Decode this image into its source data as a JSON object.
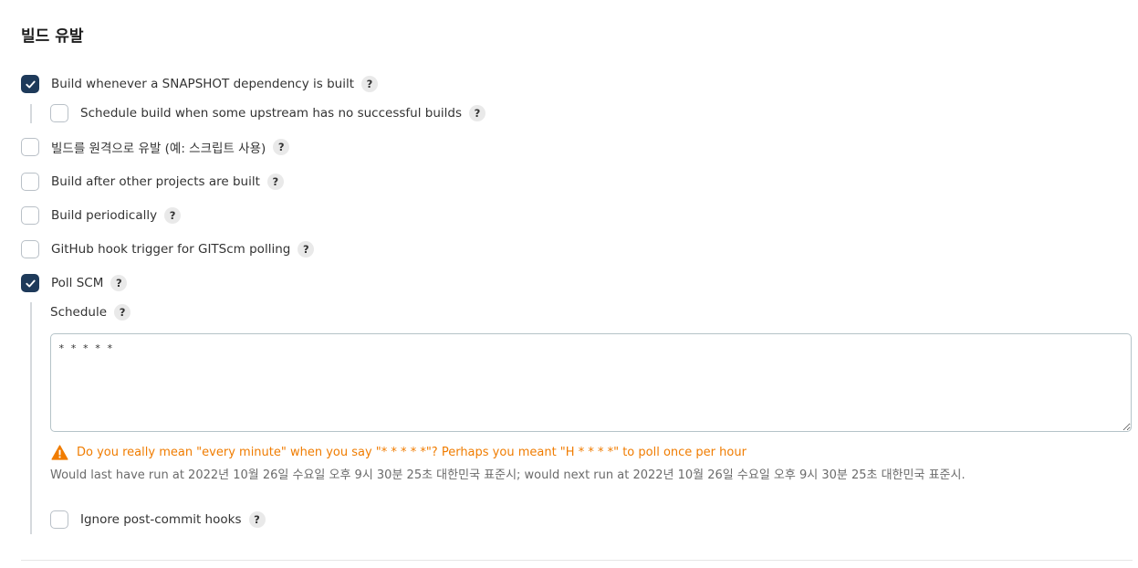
{
  "section": {
    "title": "빌드 유발"
  },
  "triggers": [
    {
      "label": "Build whenever a SNAPSHOT dependency is built",
      "checked": true,
      "help": "?"
    },
    {
      "label": "Schedule build when some upstream has no successful builds",
      "checked": false,
      "help": "?"
    },
    {
      "label": "빌드를 원격으로 유발 (예: 스크립트 사용)",
      "checked": false,
      "help": "?"
    },
    {
      "label": "Build after other projects are built",
      "checked": false,
      "help": "?"
    },
    {
      "label": "Build periodically",
      "checked": false,
      "help": "?"
    },
    {
      "label": "GitHub hook trigger for GITScm polling",
      "checked": false,
      "help": "?"
    },
    {
      "label": "Poll SCM",
      "checked": true,
      "help": "?"
    }
  ],
  "poll_scm": {
    "schedule_label": "Schedule",
    "schedule_help": "?",
    "schedule_value": "* * * * *",
    "warning": "Do you really mean \"every minute\" when you say \"* * * * *\"? Perhaps you meant \"H * * * *\" to poll once per hour",
    "info": "Would last have run at 2022년 10월 26일 수요일 오후 9시 30분 25초 대한민국 표준시; would next run at 2022년 10월 26일 수요일 오후 9시 30분 25초 대한민국 표준시.",
    "ignore_hooks": {
      "label": "Ignore post-commit hooks",
      "checked": false,
      "help": "?"
    }
  },
  "colors": {
    "checked": "#1e3a5a",
    "warning": "#f07c00",
    "info": "#6b6b6b"
  }
}
